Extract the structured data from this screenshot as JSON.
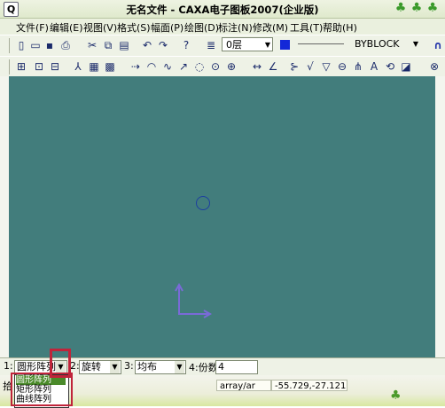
{
  "window": {
    "title": "无名文件 - CAXA电子图板2007(企业版)",
    "app_icon": "Q"
  },
  "menu": [
    "文件(F)",
    "编辑(E)",
    "视图(V)",
    "格式(S)",
    "幅面(P)",
    "绘图(D)",
    "标注(N)",
    "修改(M)",
    "工具(T)",
    "帮助(H)"
  ],
  "toolbar": {
    "layer_value": "0层",
    "linetype_value": "BYBLOCK"
  },
  "command": {
    "field1_label": "1:",
    "field1_value": "圆形阵列",
    "field2_label": "2:",
    "field2_value": "旋转",
    "field3_label": "3:",
    "field3_value": "均布",
    "field4_label": "4:份数",
    "field4_value": "4",
    "options": [
      "圆形阵列",
      "矩形阵列",
      "曲线阵列"
    ],
    "partial_prompt": "拾"
  },
  "status": {
    "command_name": "array/ar",
    "coordinates": "-55.729,-27.121"
  },
  "colors": {
    "canvas": "#427d7c",
    "highlight": "#c0243a",
    "axis": "#7a6ad8"
  }
}
